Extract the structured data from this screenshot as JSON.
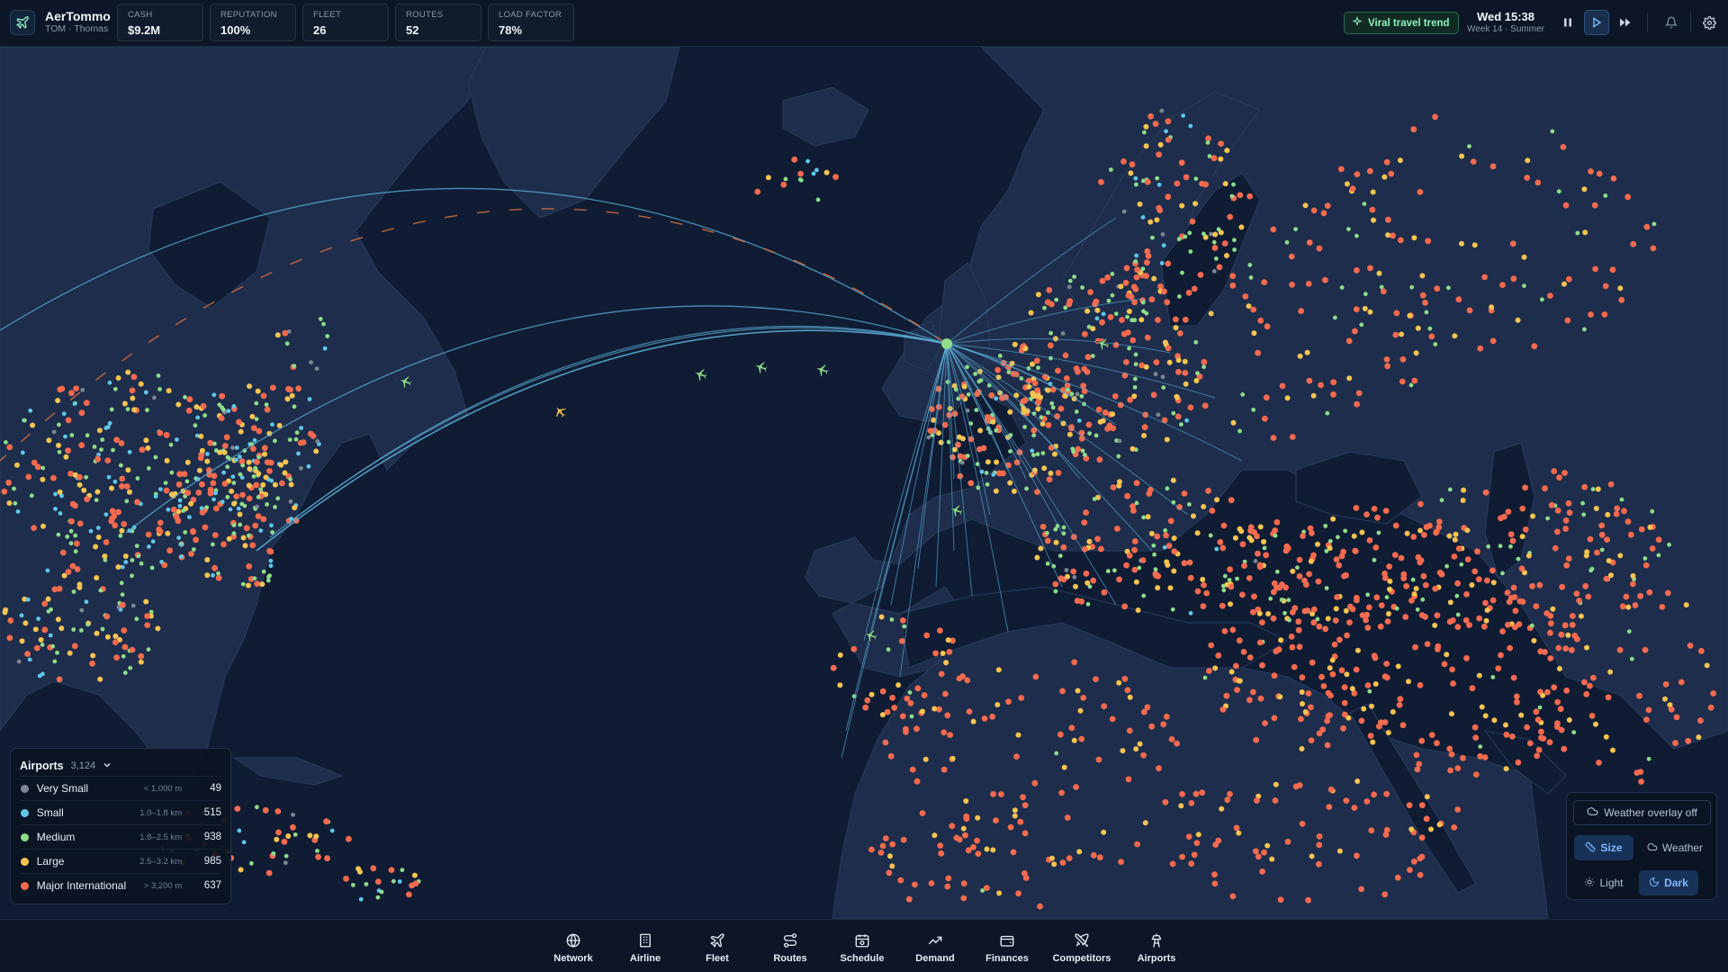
{
  "app": {
    "name": "AerTommo",
    "player": "TOM · Thomas",
    "logo_icon": "plane-icon"
  },
  "stats": [
    {
      "label": "CASH",
      "value": "$9.2M"
    },
    {
      "label": "REPUTATION",
      "value": "100%"
    },
    {
      "label": "FLEET",
      "value": "26"
    },
    {
      "label": "ROUTES",
      "value": "52"
    },
    {
      "label": "LOAD FACTOR",
      "value": "78%"
    }
  ],
  "event": {
    "label": "Viral travel trend",
    "icon": "sparkle-icon",
    "color": "#8ff0c2"
  },
  "clock": {
    "time": "Wed 15:38",
    "week": "Week 14 · Summer"
  },
  "controls": {
    "pause_icon": "pause-icon",
    "play_icon": "play-icon",
    "fast_icon": "fast-forward-icon",
    "bell_icon": "bell-icon",
    "settings_icon": "gear-icon",
    "active": "play"
  },
  "legend": {
    "title": "Airports",
    "count": "3,124",
    "rows": [
      {
        "name": "Very Small",
        "range": "< 1,000 m",
        "count": "49",
        "color": "#7d8693"
      },
      {
        "name": "Small",
        "range": "1.0–1.8 km",
        "count": "515",
        "color": "#5fc7e8"
      },
      {
        "name": "Medium",
        "range": "1.8–2.5 km",
        "count": "938",
        "color": "#8fdc8a"
      },
      {
        "name": "Large",
        "range": "2.5–3.2 km",
        "count": "985",
        "color": "#f5c451"
      },
      {
        "name": "Major International",
        "range": "> 3,200 m",
        "count": "637",
        "color": "#f26a4f"
      }
    ]
  },
  "map_controls": {
    "weather_overlay": "Weather overlay off",
    "size_label": "Size",
    "weather_label": "Weather",
    "light_label": "Light",
    "dark_label": "Dark",
    "active_mode": "Size",
    "active_theme": "Dark"
  },
  "nav": [
    {
      "label": "Network",
      "icon": "globe-icon"
    },
    {
      "label": "Airline",
      "icon": "building-icon"
    },
    {
      "label": "Fleet",
      "icon": "plane-icon"
    },
    {
      "label": "Routes",
      "icon": "route-icon"
    },
    {
      "label": "Schedule",
      "icon": "calendar-icon"
    },
    {
      "label": "Demand",
      "icon": "trend-icon"
    },
    {
      "label": "Finances",
      "icon": "wallet-icon"
    },
    {
      "label": "Competitors",
      "icon": "swords-icon"
    },
    {
      "label": "Airports",
      "icon": "tower-icon"
    }
  ],
  "colors": {
    "ocean": "#0f1c34",
    "land": "#1d2d4b",
    "route": "#5fb4dc",
    "competitor_route": "#e0703f"
  }
}
